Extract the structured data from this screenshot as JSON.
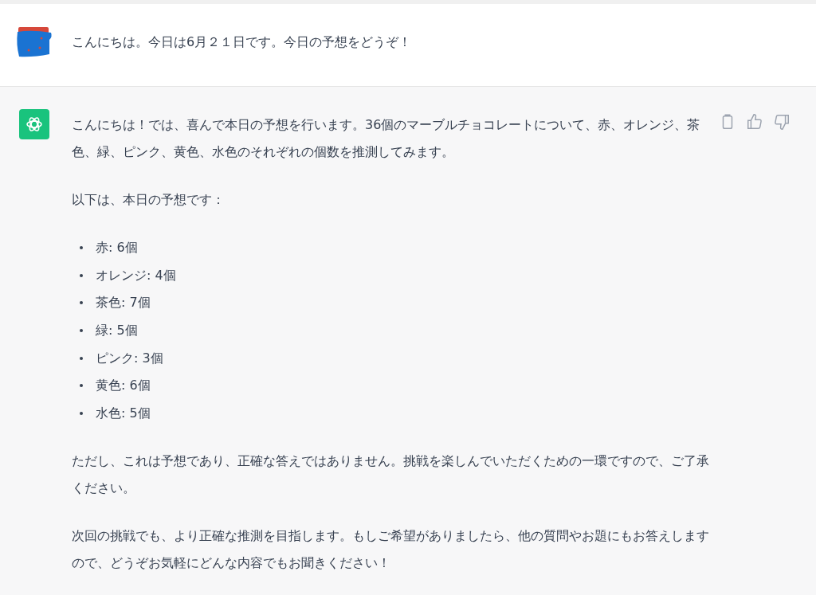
{
  "user_message": {
    "text": "こんにちは。今日は6月２１日です。今日の予想をどうぞ！"
  },
  "assistant_message": {
    "paragraphs_before": [
      "こんにちは！では、喜んで本日の予想を行います。36個のマーブルチョコレートについて、赤、オレンジ、茶色、緑、ピンク、黄色、水色のそれぞれの個数を推測してみます。",
      "以下は、本日の予想です："
    ],
    "list": [
      "赤: 6個",
      "オレンジ: 4個",
      "茶色: 7個",
      "緑: 5個",
      "ピンク: 3個",
      "黄色: 6個",
      "水色: 5個"
    ],
    "paragraphs_after": [
      "ただし、これは予想であり、正確な答えではありません。挑戦を楽しんでいただくための一環ですので、ご了承ください。",
      "次回の挑戦でも、より正確な推測を目指します。もしご希望がありましたら、他の質問やお題にもお答えしますので、どうぞお気軽にどんな内容でもお聞きください！"
    ]
  }
}
